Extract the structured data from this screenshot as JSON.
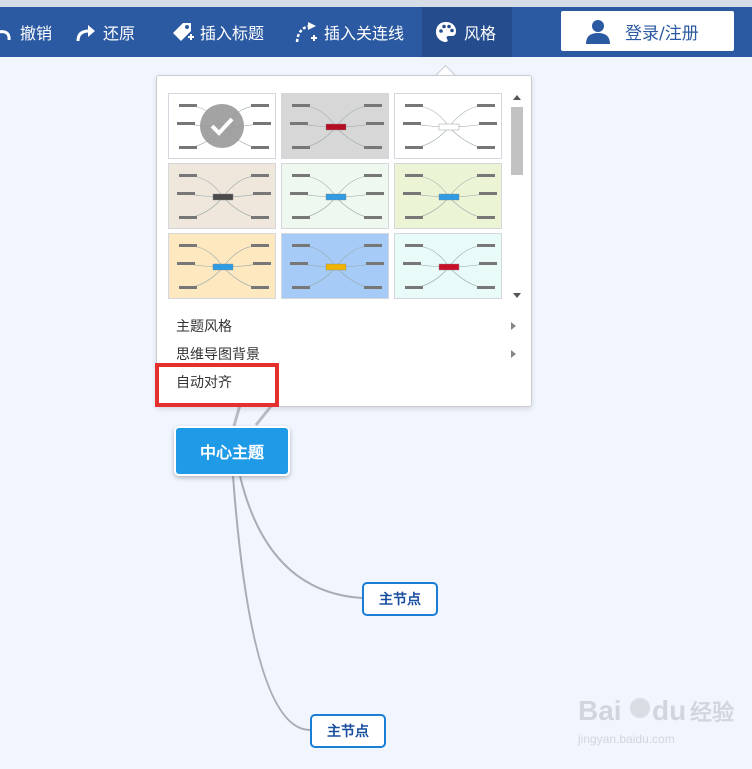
{
  "toolbar": {
    "undo_label": "撤销",
    "redo_label": "还原",
    "insert_title_label": "插入标题",
    "insert_link_label": "插入关连线",
    "style_label": "风格",
    "login_label": "登录/注册"
  },
  "style_menu": {
    "items": [
      {
        "label": "主题风格"
      },
      {
        "label": "思维导图背景"
      },
      {
        "label": "自动对齐"
      }
    ],
    "themes": [
      {
        "bg": "#ffffff",
        "center": "#e8eef7",
        "selected": true
      },
      {
        "bg": "#d7d7d7",
        "center": "#b50d24",
        "selected": false
      },
      {
        "bg": "#ffffff",
        "center": "#ffffff",
        "selected": false
      },
      {
        "bg": "#efe6dc",
        "center": "#4a4a4a",
        "selected": false
      },
      {
        "bg": "#eef8ee",
        "center": "#2e9be3",
        "selected": false
      },
      {
        "bg": "#ebf5d6",
        "center": "#2e9be3",
        "selected": false
      },
      {
        "bg": "#fde8bf",
        "center": "#2e9be3",
        "selected": false
      },
      {
        "bg": "#a5cbf6",
        "center": "#f0b400",
        "selected": false
      },
      {
        "bg": "#e8fbf8",
        "center": "#c90f2a",
        "selected": false
      }
    ]
  },
  "mindmap": {
    "center_label": "中心主题",
    "main_nodes": [
      {
        "label": "主节点"
      },
      {
        "label": "主节点"
      }
    ]
  },
  "colors": {
    "toolbar": "#2b5aa3",
    "center_node": "#1f9ae7",
    "highlight": "#e5312d"
  }
}
